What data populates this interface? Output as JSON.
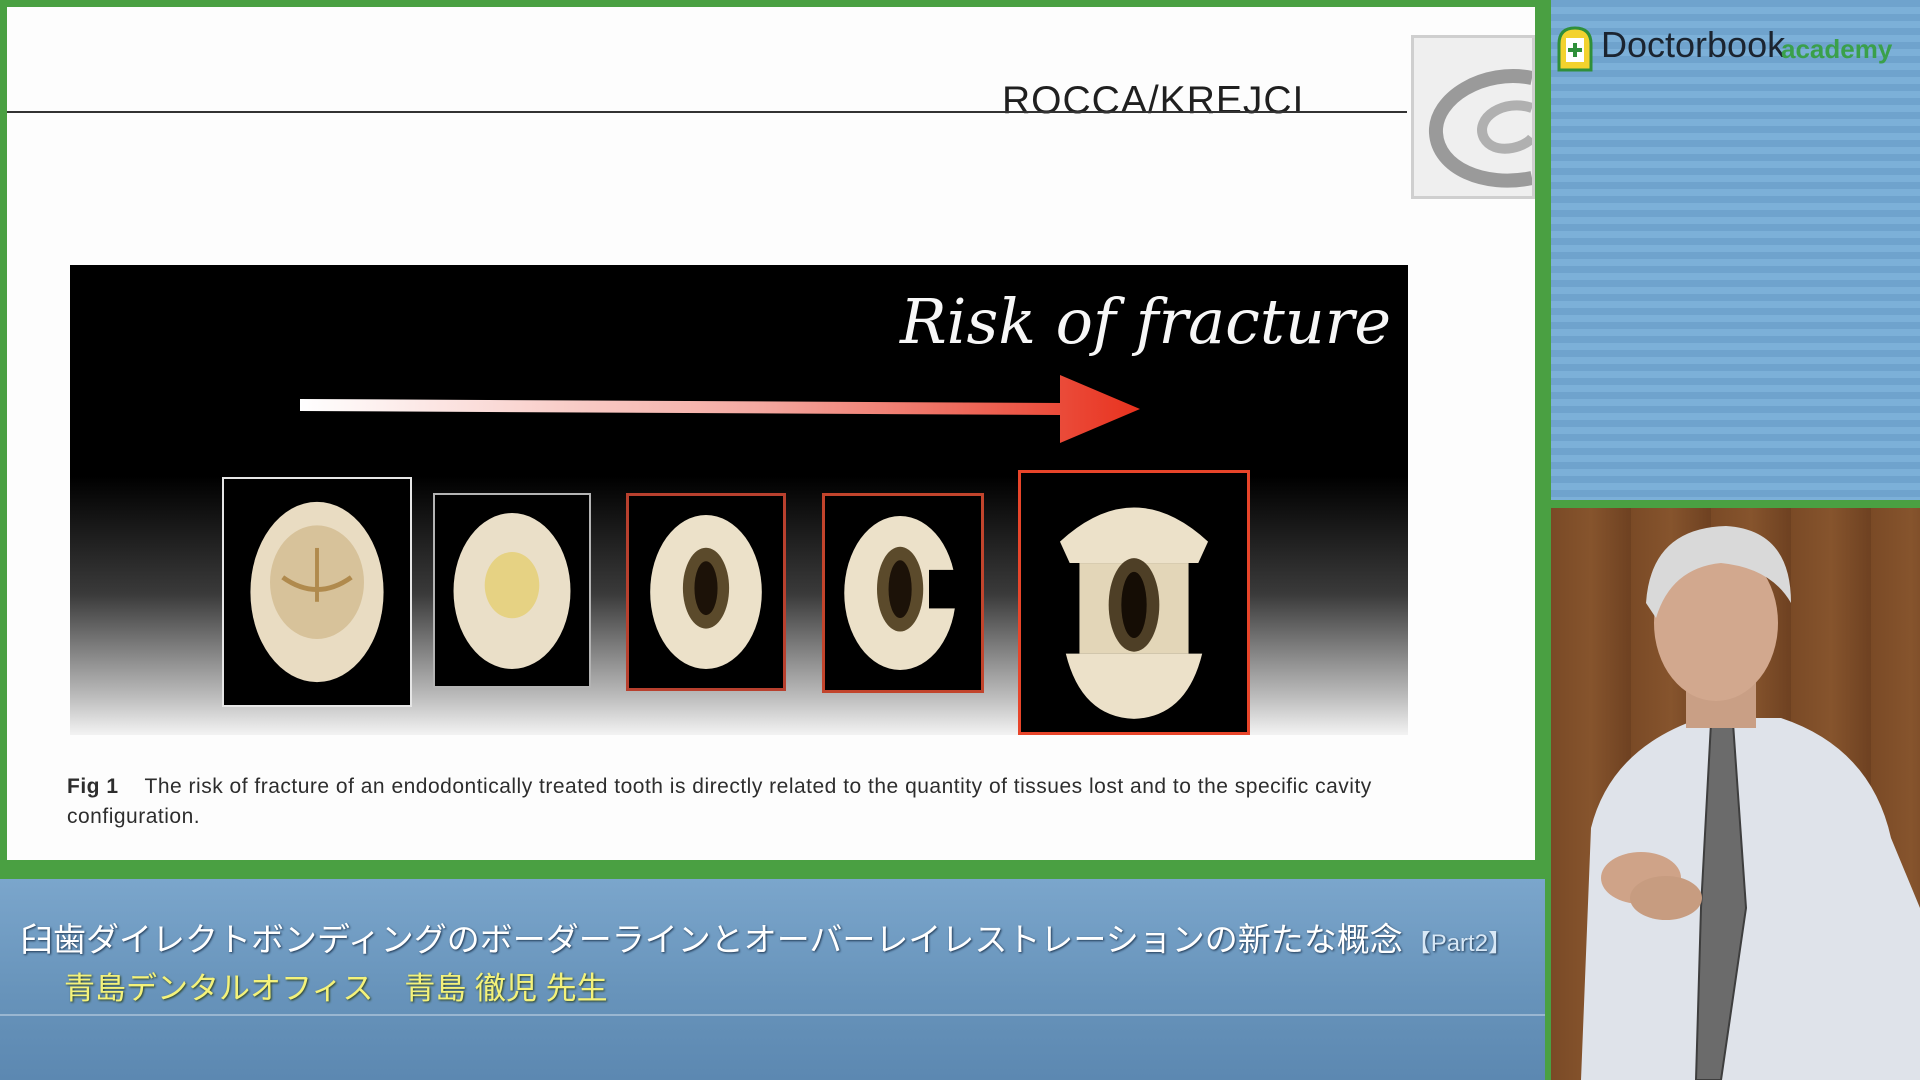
{
  "slide": {
    "author": "ROCCA/KREJCI",
    "figure_title": "Risk of fracture",
    "caption_label": "Fig 1",
    "caption_text": "The risk of fracture of an endodontically treated tooth is directly related to the quantity of tissues lost and to the specific cavity configuration."
  },
  "lecture": {
    "title": "臼歯ダイレクトボンディングのボーダーラインとオーバーレイレストレーションの新たな概念",
    "part": "【Part2】",
    "presenter": "青島デンタルオフィス　青島 徹児 先生"
  },
  "brand": {
    "name": "Doctorbook",
    "sub": "academy"
  },
  "colors": {
    "frame_green": "#4aa042",
    "arrow_red": "#e8321e",
    "presenter_yellow": "#f4f27a"
  }
}
